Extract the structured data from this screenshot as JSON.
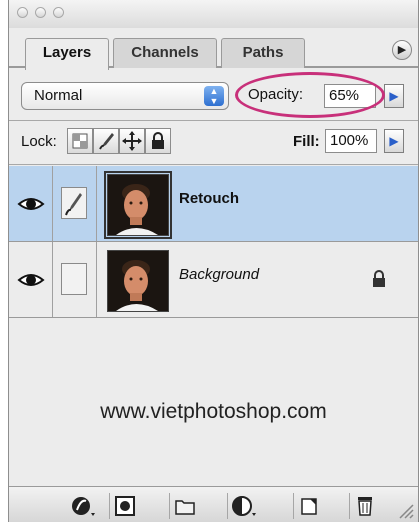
{
  "tabs": [
    {
      "label": "Layers",
      "active": true
    },
    {
      "label": "Channels",
      "active": false
    },
    {
      "label": "Paths",
      "active": false
    }
  ],
  "blend_mode": "Normal",
  "opacity": {
    "label": "Opacity:",
    "value": "65%"
  },
  "lock_label": "Lock:",
  "fill": {
    "label": "Fill:",
    "value": "100%"
  },
  "layers": [
    {
      "name": "Retouch",
      "visible": true,
      "selected": true,
      "bold": true
    },
    {
      "name": "Background",
      "visible": true,
      "selected": false,
      "italic": true,
      "locked": true
    }
  ],
  "watermark": "www.vietphotoshop.com",
  "colors": {
    "highlight": "#c8307a",
    "selected_row": "#b9d3ee",
    "accent": "#2e6fd0"
  }
}
